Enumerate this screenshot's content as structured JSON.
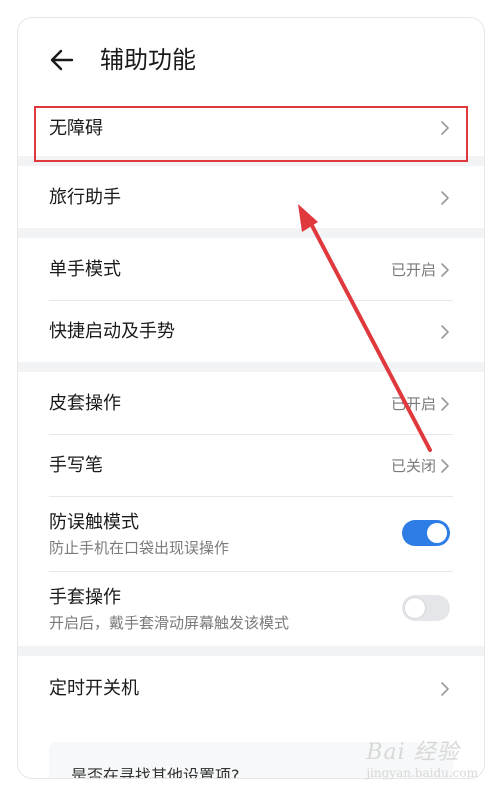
{
  "header": {
    "title": "辅助功能",
    "back_icon": "arrow-left-icon"
  },
  "items": {
    "accessibility": {
      "label": "无障碍"
    },
    "travel_assistant": {
      "label": "旅行助手"
    },
    "one_hand_mode": {
      "label": "单手模式",
      "value": "已开启"
    },
    "quick_launch": {
      "label": "快捷启动及手势"
    },
    "cover_ops": {
      "label": "皮套操作",
      "value": "已开启"
    },
    "stylus": {
      "label": "手写笔",
      "value": "已关闭"
    },
    "anti_mistouch": {
      "label": "防误触模式",
      "sublabel": "防止手机在口袋出现误操作",
      "enabled": true
    },
    "glove_mode": {
      "label": "手套操作",
      "sublabel": "开启后，戴手套滑动屏幕触发该模式",
      "enabled": false
    },
    "scheduled_power": {
      "label": "定时开关机"
    }
  },
  "search_card": {
    "text": "是否在寻找其他设置项?"
  },
  "annotation": {
    "highlight_color": "#e0393d",
    "arrow_color": "#e0393d"
  },
  "watermark": {
    "text": "Bai 经验",
    "url": "jingyan.baidu.com"
  },
  "colors": {
    "toggle_on": "#2e7de6",
    "background": "#f1f3f5"
  }
}
